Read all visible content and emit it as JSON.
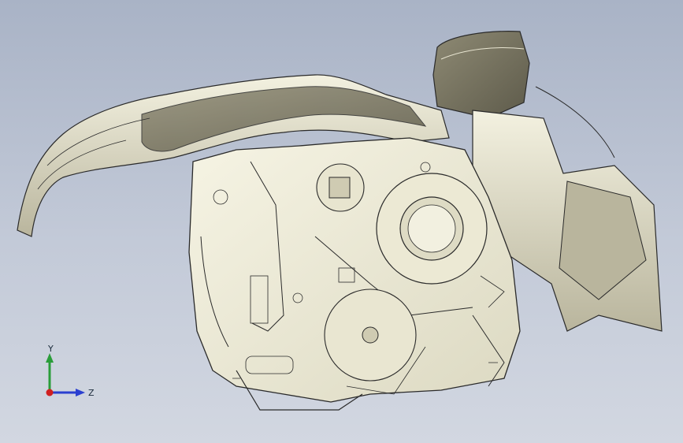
{
  "viewport": {
    "background_top": "#a9b3c6",
    "background_bottom": "#d2d7e1",
    "model_fill": "#efedd9",
    "model_shadow": "#a9a590",
    "edge_color": "#2a2a2a"
  },
  "triad": {
    "x_label": "Y",
    "z_label": "Z",
    "y_axis_color": "#2a9d3a",
    "z_axis_color": "#2a3fd0",
    "x_axis_color": "#d02020"
  }
}
